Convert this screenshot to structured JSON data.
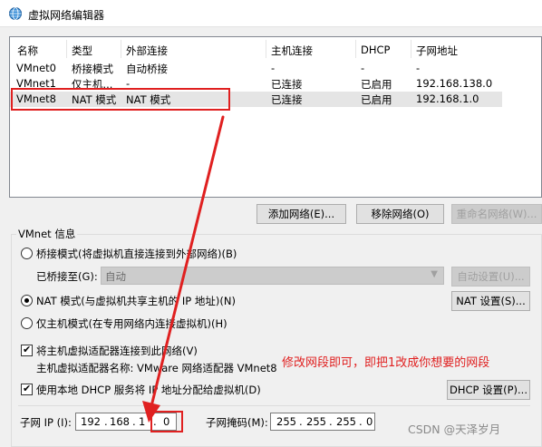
{
  "window": {
    "title": "虚拟网络编辑器"
  },
  "table": {
    "headers": [
      "名称",
      "类型",
      "外部连接",
      "主机连接",
      "DHCP",
      "子网地址"
    ],
    "rows": [
      [
        "VMnet0",
        "桥接模式",
        "自动桥接",
        "-",
        "-",
        "-"
      ],
      [
        "VMnet1",
        "仅主机...",
        "-",
        "已连接",
        "已启用",
        "192.168.138.0"
      ],
      [
        "VMnet8",
        "NAT 模式",
        "NAT 模式",
        "已连接",
        "已启用",
        "192.168.1.0"
      ]
    ],
    "selected_row": 2
  },
  "buttons": {
    "add_network": "添加网络(E)...",
    "remove_network": "移除网络(O)",
    "rename_network": "重命名网络(W)..."
  },
  "vmnet_info": {
    "group_label": "VMnet 信息",
    "bridge_mode": "桥接模式(将虚拟机直接连接到外部网络)(B)",
    "bridged_to_label": "已桥接至(G):",
    "bridged_to_value": "自动",
    "auto_settings": "自动设置(U)...",
    "nat_mode": "NAT 模式(与虚拟机共享主机的 IP 地址)(N)",
    "nat_settings": "NAT 设置(S)...",
    "host_only_mode": "仅主机模式(在专用网络内连接虚拟机)(H)",
    "selected_mode": "nat",
    "connect_adapter": "将主机虚拟适配器连接到此网络(V)",
    "connect_adapter_checked": true,
    "adapter_name": "主机虚拟适配器名称: VMware 网络适配器 VMnet8",
    "use_dhcp": "使用本地 DHCP 服务将 IP 地址分配给虚拟机(D)",
    "use_dhcp_checked": true,
    "dhcp_settings": "DHCP 设置(P)...",
    "subnet_ip_label": "子网 IP (I):",
    "subnet_ip": [
      "192",
      "168",
      "1",
      "0"
    ],
    "subnet_mask_label": "子网掩码(M):",
    "subnet_mask": [
      "255",
      "255",
      "255",
      "0"
    ]
  },
  "annotation": {
    "text": "修改网段即可，即把1改成你想要的网段",
    "color": "#e02020"
  },
  "watermark": "CSDN @天泽岁月",
  "icons": {
    "title_icon": "globe-network-icon",
    "arrow": "red-arrow-icon",
    "dropdown": "chevron-down-icon"
  },
  "colors": {
    "annotation": "#e02020",
    "selection": "#e5e5e5",
    "accent": "#0078d7"
  }
}
